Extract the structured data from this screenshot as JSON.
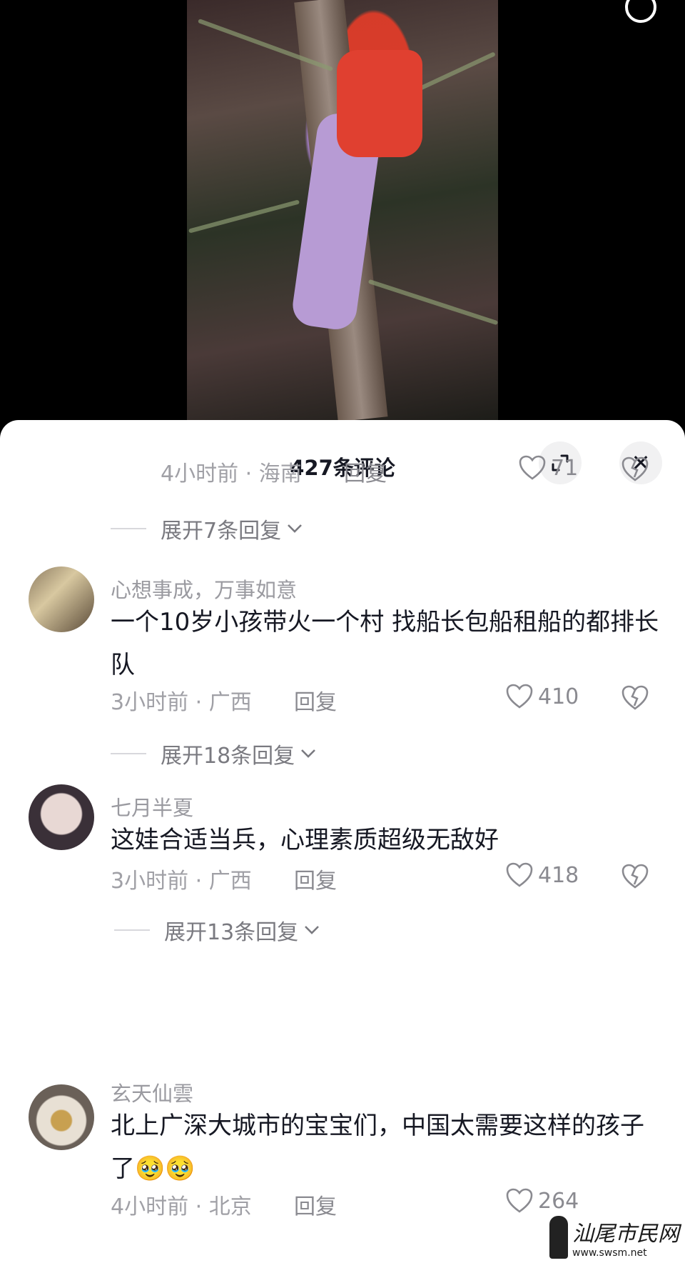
{
  "header": {
    "title": "427条评论"
  },
  "comments": [
    {
      "meta_time": "4小时前",
      "meta_location": "海南",
      "reply_label": "回复",
      "likes": "71",
      "expand_label": "展开7条回复"
    },
    {
      "username": "心想事成，万事如意",
      "content": "一个10岁小孩带火一个村   找船长包船租船的都排长队",
      "meta_time": "3小时前",
      "meta_location": "广西",
      "reply_label": "回复",
      "likes": "410",
      "expand_label": "展开18条回复"
    },
    {
      "username": "七月半夏",
      "content": "这娃合适当兵，心理素质超级无敌好",
      "meta_time": "3小时前",
      "meta_location": "广西",
      "reply_label": "回复",
      "likes": "418",
      "expand_label": "展开13条回复"
    },
    {
      "username": "玄天仙雲",
      "content": "北上广深大城市的宝宝们，中国太需要这样的孩子了🥹🥹",
      "meta_time": "4小时前",
      "meta_location": "北京",
      "reply_label": "回复",
      "likes": "264"
    }
  ],
  "meta_separator": " · ",
  "watermark": {
    "name": "汕尾市民网",
    "url": "www.swsm.net"
  },
  "colors": {
    "sheet_bg": "#ffffff",
    "title_text": "#161823",
    "secondary_text": "#a0a0a6"
  }
}
